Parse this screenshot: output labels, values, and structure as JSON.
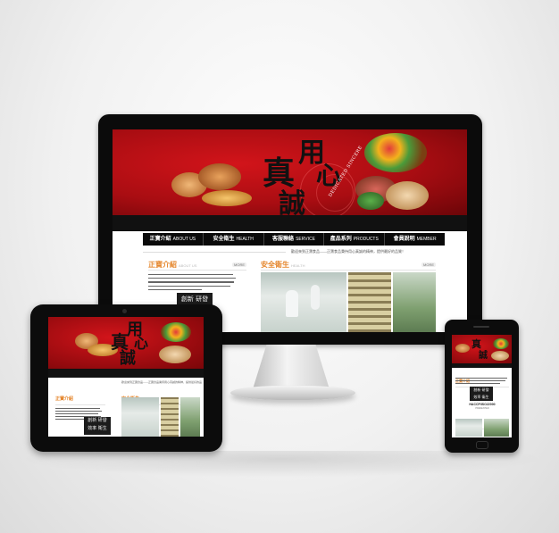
{
  "colors": {
    "brand_red": "#c8161d",
    "accent_orange": "#e5872e",
    "nav_black": "#0a0a0a",
    "background": "#eeeeee"
  },
  "hero": {
    "calligraphy": [
      "用",
      "心",
      "真",
      "誠"
    ],
    "english_tagline": "DEDICATED SINCERE"
  },
  "nav": {
    "items": [
      {
        "label": "正寶介紹",
        "sub": "ABOUT US"
      },
      {
        "label": "安全衛生",
        "sub": "HEALTH"
      },
      {
        "label": "客服聯絡",
        "sub": "SERVICE"
      },
      {
        "label": "產品系列",
        "sub": "PRODUCTS"
      },
      {
        "label": "會員說明",
        "sub": "MEMBER"
      }
    ]
  },
  "ticker": "歡迎來到正寶食品——正寶食品秉持用心真誠的精神，提供最好的品質！",
  "sections": {
    "about": {
      "title": "正寶介紹",
      "sub": "ABOUT US",
      "more": "MORE"
    },
    "health": {
      "title": "安全衛生",
      "sub": "HEALTH",
      "more": "MORE"
    }
  },
  "innovation_box": {
    "label": "創新 研發",
    "label2": "效率 衛生"
  },
  "haccp": {
    "label": "HACCP/ISO22000",
    "sub": "PRESENTED"
  },
  "photo_icons": [
    "factory-worker-photo",
    "oven-rack-photo",
    "production-line-photo"
  ]
}
